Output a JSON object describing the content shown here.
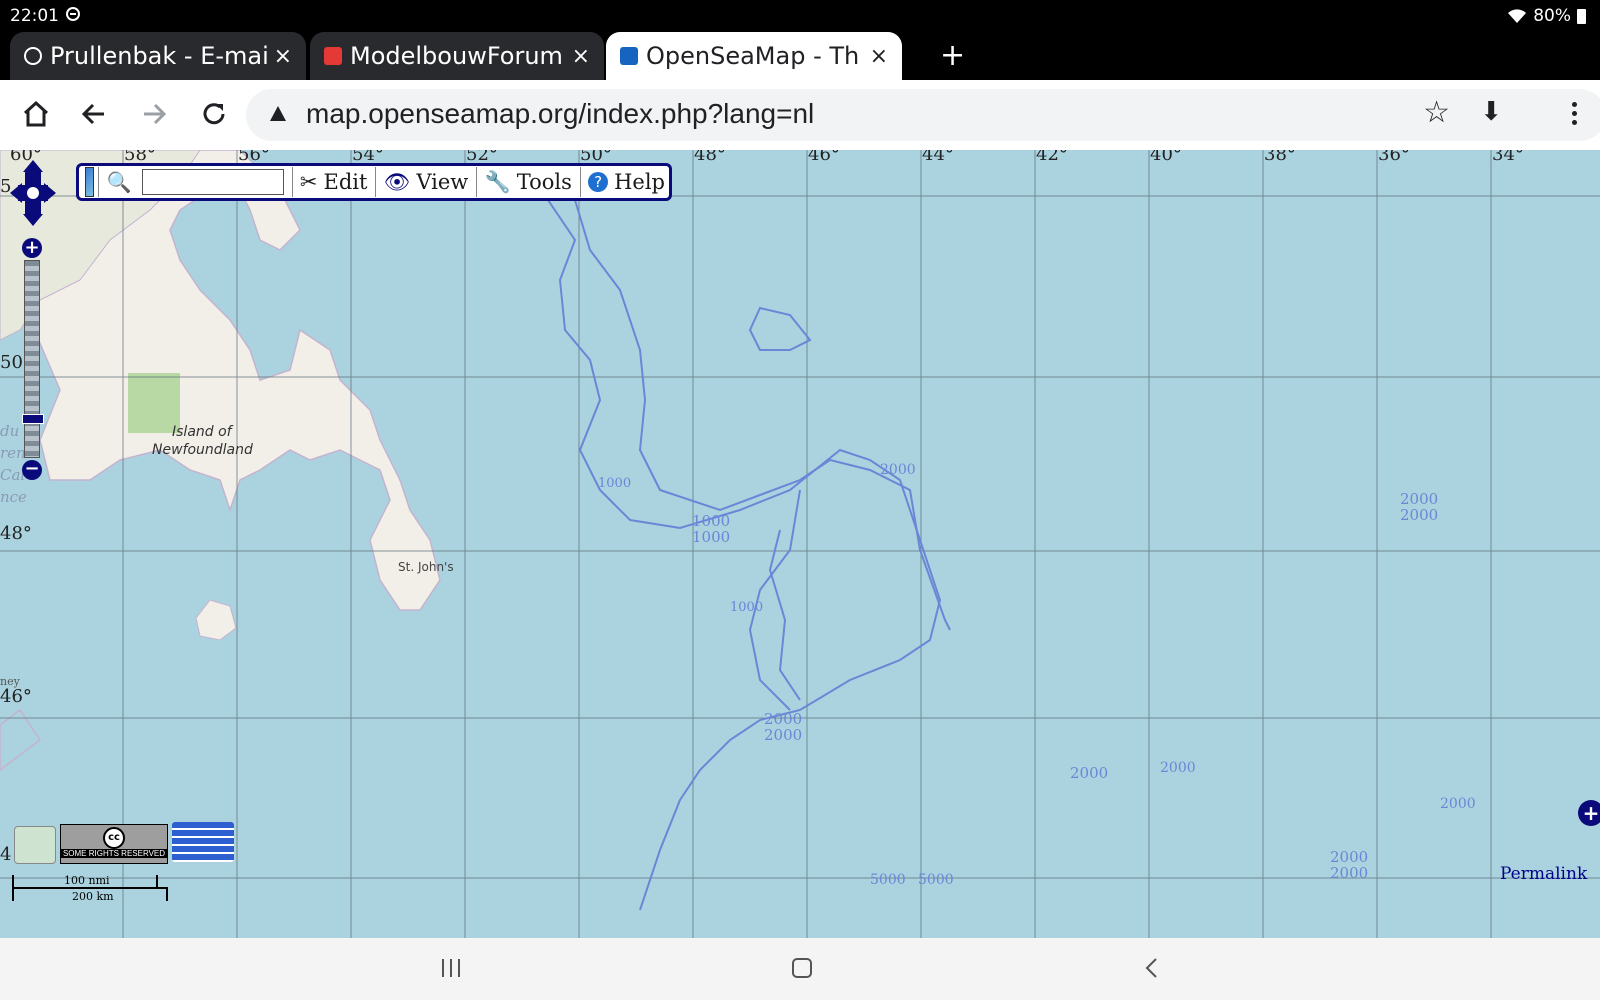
{
  "status": {
    "time": "22:01",
    "battery": "80%"
  },
  "tabs": [
    {
      "title": "Prullenbak - E-mail",
      "close": "×",
      "active": false,
      "favicon_color": "#ff6f00"
    },
    {
      "title": "ModelbouwForum.n",
      "close": "×",
      "active": false,
      "favicon_color": "#e53935"
    },
    {
      "title": "OpenSeaMap - The",
      "close": "×",
      "active": true,
      "favicon_color": "#1565c0"
    }
  ],
  "newtab_label": "+",
  "browser": {
    "url": "map.openseamap.org/index.php?lang=nl",
    "icons": [
      "home-icon",
      "back-icon",
      "forward-icon",
      "reload-icon",
      "not-secure-icon",
      "star-icon",
      "download-icon",
      "menu-icon"
    ]
  },
  "osm_toolbar": {
    "search_value": "",
    "edit": "Edit",
    "view": "View",
    "tools": "Tools",
    "help": "Help"
  },
  "map": {
    "longitudes": [
      "60°",
      "58°",
      "56°",
      "54°",
      "52°",
      "50°",
      "48°",
      "46°",
      "44°",
      "42°",
      "40°",
      "38°",
      "36°",
      "34°"
    ],
    "latitudes": [
      "50°",
      "48°",
      "46°"
    ],
    "partial_lat_labels": [
      "5",
      "4"
    ],
    "places": [
      "Island of",
      "Newfoundland",
      "St. John's"
    ],
    "depths": {
      "d2000_a": "2000",
      "d2000_b": "2000",
      "d1000_a": "1000",
      "d1000_b": "1000",
      "d2000_c": "2000",
      "d2000_d": "2000",
      "d2000_e": "2000",
      "d2000_f": "2000",
      "d2000_g": "2000",
      "d5000_a": "5000",
      "d5000_b": "5000",
      "d2000_h": "2000",
      "d1000_c": "1000",
      "d1000_d": "1000",
      "d2000_i": "2000",
      "d2000_j": "2000"
    },
    "left_edge_fragments": [
      "du",
      "rent",
      "Cal",
      "nce",
      "ney"
    ],
    "scale": {
      "nmi": "100 nmi",
      "km": "200 km"
    },
    "cc_text": "SOME RIGHTS RESERVED",
    "permalink": "Permalink"
  },
  "colors": {
    "sea": "#abd3df",
    "land": "#f2efe9",
    "contour": "#6a86d6",
    "grid": "#5a6b78",
    "toolbar_border": "#0a0a7a"
  }
}
